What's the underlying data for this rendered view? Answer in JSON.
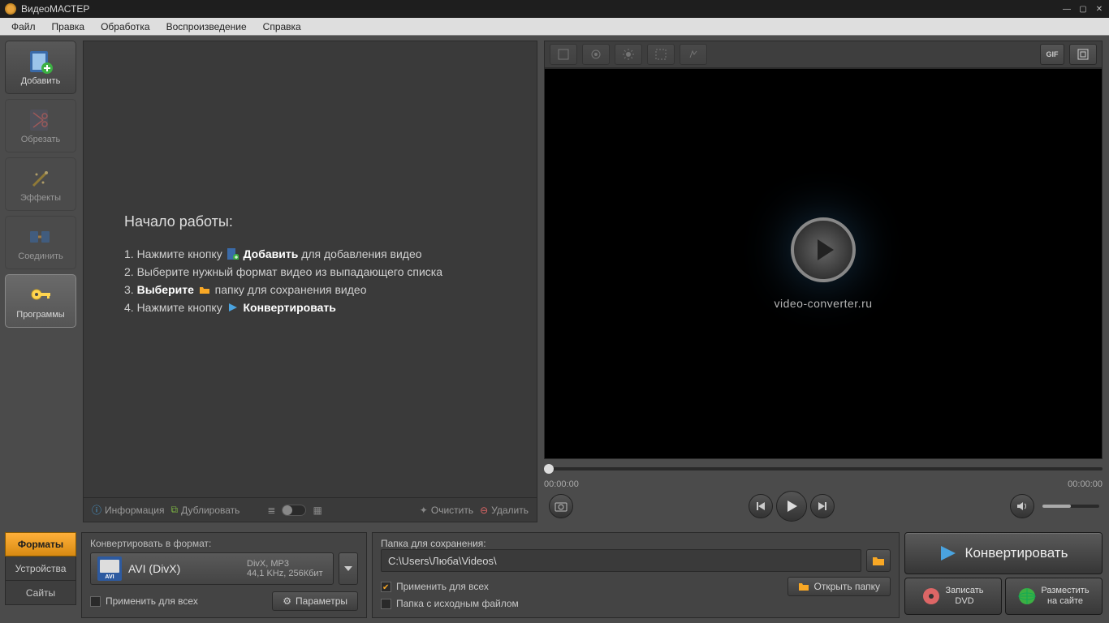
{
  "app": {
    "title": "ВидеоМАСТЕР"
  },
  "menu": {
    "file": "Файл",
    "edit": "Правка",
    "process": "Обработка",
    "playback": "Воспроизведение",
    "help": "Справка"
  },
  "sidebar": {
    "add": "Добавить",
    "cut": "Обрезать",
    "effects": "Эффекты",
    "join": "Соединить",
    "programs": "Программы"
  },
  "getting_started": {
    "heading": "Начало работы:",
    "l1a": "1. Нажмите кнопку ",
    "l1b": "Добавить",
    "l1c": " для добавления видео",
    "l2": "2. Выберите нужный формат видео из выпадающего списка",
    "l3a": "3. ",
    "l3b": "Выберите",
    "l3c": " папку для сохранения видео",
    "l4a": "4. Нажмите кнопку ",
    "l4b": "Конвертировать"
  },
  "filebar": {
    "info": "Информация",
    "dup": "Дублировать",
    "clear": "Очистить",
    "delete": "Удалить"
  },
  "preview": {
    "brand": "video-converter.ru",
    "t0": "00:00:00",
    "t1": "00:00:00"
  },
  "tabs": {
    "formats": "Форматы",
    "devices": "Устройства",
    "sites": "Сайты"
  },
  "fmt": {
    "label": "Конвертировать в формат:",
    "name": "AVI (DivX)",
    "badge": "AVI",
    "det1": "DivX, MP3",
    "det2": "44,1 KHz, 256Кбит",
    "apply": "Применить для всех",
    "params": "Параметры"
  },
  "folder": {
    "label": "Папка для сохранения:",
    "path": "C:\\Users\\Люба\\Videos\\",
    "apply": "Применить для всех",
    "same": "Папка с исходным файлом",
    "open": "Открыть папку"
  },
  "actions": {
    "convert": "Конвертировать",
    "burn": "Записать\nDVD",
    "upload": "Разместить\nна сайте"
  }
}
